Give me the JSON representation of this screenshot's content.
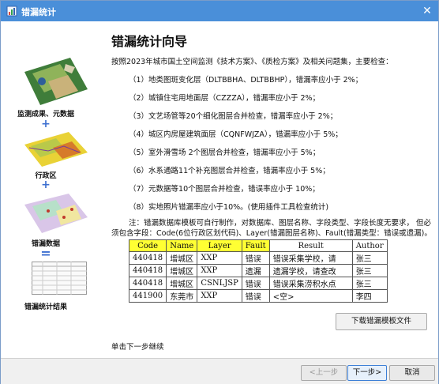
{
  "window": {
    "title": "错漏统计",
    "close_glyph": "✕"
  },
  "heading": "错漏统计向导",
  "left_panel": {
    "items": [
      {
        "caption": "监测成果、元数据"
      },
      {
        "caption": "行政区"
      },
      {
        "caption": "错漏数据"
      },
      {
        "caption": "错漏统计结果"
      }
    ],
    "plus": "+",
    "equals": "="
  },
  "intro": "按照2023年城市国土空间监测《技术方案》、《质检方案》及相关问题集，主要检查：",
  "checks": [
    "（1）地类图斑变化层（DLTBBHA、DLTBBHP），错漏率应小于 2%；",
    "（2）城镇住宅用地面层（CZZZA），错漏率应小于 2%；",
    "（3）文艺场管等20个细化图层合并检查，错漏率应小于 2%；",
    "（4）城区内房屋建筑面层（CQNFWJZA），错漏率应小于 5%；",
    "（5）室外滑雪场 2个图层合并检查，错漏率应小于 5%；",
    "（6）水系通路11个补充图层合并检查，错漏率应小于 5%；",
    "（7）元数据等10个图层合并检查，错误率应小于 10%；",
    "（8）实地照片错漏率应小于10%。(使用插件工具检查统计)"
  ],
  "note_line1": "注：错漏数据库模板可自行制作，对数据库、图层名称、字段类型、字段长度无要求，  但必",
  "note_line2": "须包含字段：Code(6位行政区划代码)、Layer(错漏图层名称)、Fault(错漏类型：错误或遗漏)。",
  "table": {
    "headers": [
      "Code",
      "Name",
      "Layer",
      "Fault",
      "Result",
      "Author"
    ],
    "rows": [
      [
        "440418",
        "增城区",
        "XXP",
        "错误",
        "错误采集学校，请",
        "张三"
      ],
      [
        "440418",
        "增城区",
        "XXP",
        "遗漏",
        "遗漏学校，请查改",
        "张三"
      ],
      [
        "440418",
        "增城区",
        "CSNLJSP",
        "错误",
        "错误采集涝积水点",
        "张三"
      ],
      [
        "441900",
        "东莞市",
        "XXP",
        "错误",
        "<空>",
        "李四"
      ]
    ]
  },
  "download_button": "下载错漏模板文件",
  "hint": "单击下一步继续",
  "footer": {
    "prev": "<上一步",
    "next": "下一步>",
    "cancel": "取消"
  },
  "colors": {
    "titlebar": "#4a8fd9",
    "header_highlight": "#ffff33",
    "operator": "#3d6fd0"
  }
}
